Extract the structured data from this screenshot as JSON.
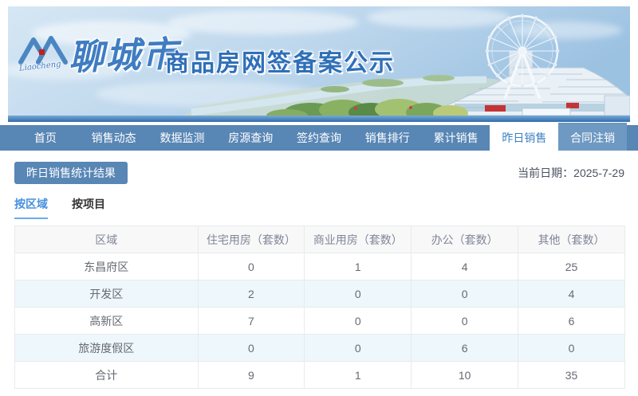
{
  "banner": {
    "logo_script": "Liaocheng",
    "city": "聊城市",
    "title": "商品房网签备案公示"
  },
  "nav": {
    "items": [
      "首页",
      "销售动态",
      "数据监测",
      "房源查询",
      "签约查询",
      "销售排行",
      "累计销售",
      "昨日销售",
      "合同注销"
    ],
    "active_item": "昨日销售"
  },
  "toolbar": {
    "section_button": "昨日销售统计结果",
    "date_label": "当前日期：2025-7-29"
  },
  "tabs": {
    "by_region": "按区域",
    "by_project": "按项目",
    "active": "按区域"
  },
  "table": {
    "headers": [
      "区域",
      "住宅用房（套数）",
      "商业用房（套数）",
      "办公（套数）",
      "其他（套数）"
    ],
    "rows": [
      [
        "东昌府区",
        "0",
        "1",
        "4",
        "25"
      ],
      [
        "开发区",
        "2",
        "0",
        "0",
        "4"
      ],
      [
        "高新区",
        "7",
        "0",
        "0",
        "6"
      ],
      [
        "旅游度假区",
        "0",
        "0",
        "6",
        "0"
      ],
      [
        "合计",
        "9",
        "1",
        "10",
        "35"
      ]
    ]
  },
  "colors": {
    "nav_bg": "#5886b5",
    "nav_active_text": "#3d7fc1",
    "accent_button": "#5886b5",
    "tab_active": "#4690de",
    "zebra_row": "#eef7fc",
    "table_border": "#e8eaec",
    "header_text": "#808695",
    "title_blue": "#2f6fb8"
  }
}
